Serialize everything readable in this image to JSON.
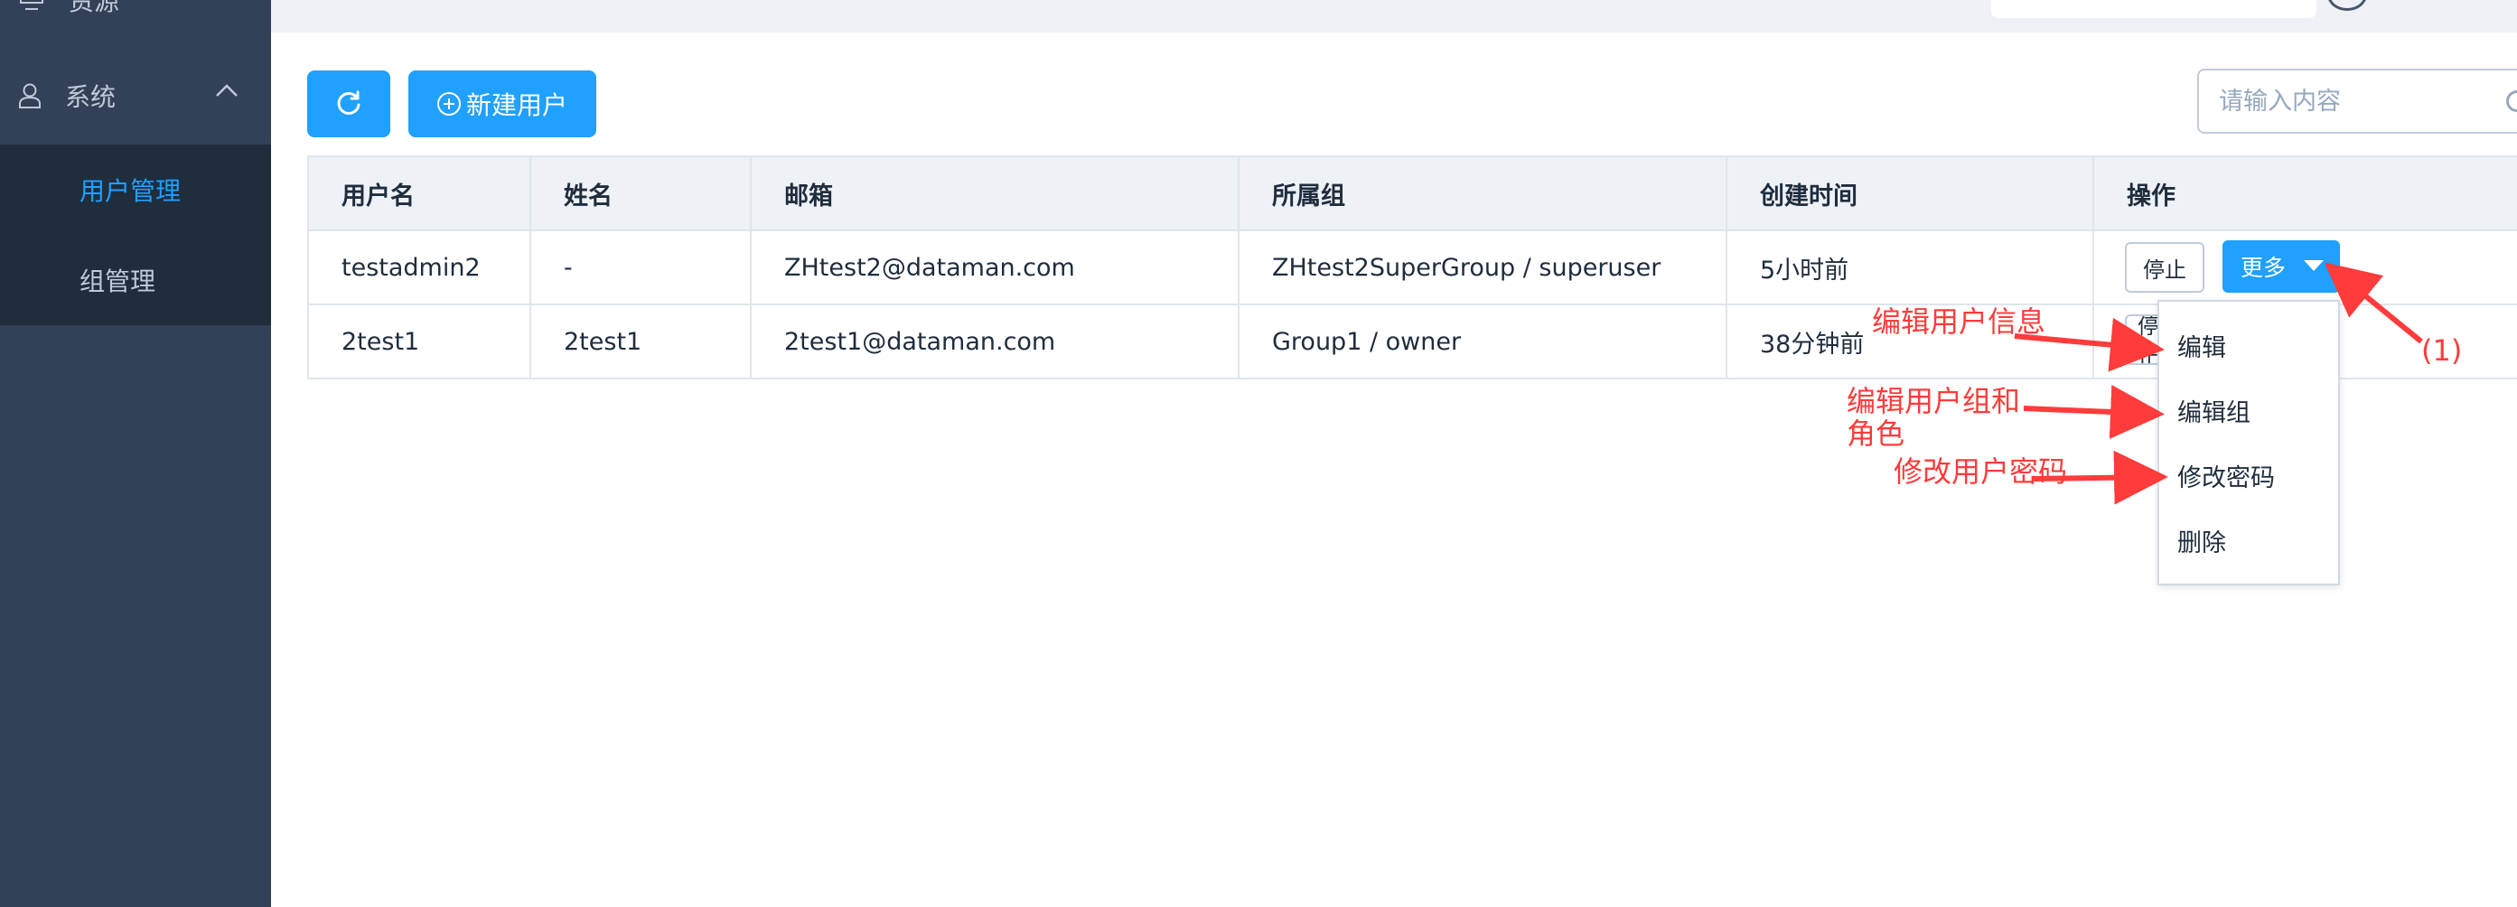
{
  "sidebar": {
    "cut_item_label": "资源",
    "group_label": "系统",
    "sub_items": [
      {
        "label": "用户管理",
        "active": true
      },
      {
        "label": "组管理",
        "active": false
      }
    ]
  },
  "toolbar": {
    "refresh_icon": "refresh-icon",
    "new_user_label": "新建用户",
    "search_placeholder": "请输入内容"
  },
  "table": {
    "headers": [
      "用户名",
      "姓名",
      "邮箱",
      "所属组",
      "创建时间",
      "操作"
    ],
    "rows": [
      {
        "username": "testadmin2",
        "name": "-",
        "email": "ZHtest2@dataman.com",
        "group": "ZHtest2SuperGroup / superuser",
        "created": "5小时前"
      },
      {
        "username": "2test1",
        "name": "2test1",
        "email": "2test1@dataman.com",
        "group": "Group1 / owner",
        "created": "38分钟前"
      }
    ],
    "stop_label": "停止",
    "more_label": "更多"
  },
  "dropdown": {
    "items": [
      "编辑",
      "编辑组",
      "修改密码",
      "删除"
    ]
  },
  "annotations": {
    "edit_info": "编辑用户信息",
    "edit_group_line1": "编辑用户组和",
    "edit_group_line2": "角色",
    "change_password": "修改用户密码",
    "step": "(1)"
  },
  "colors": {
    "sidebar_bg": "#324157",
    "submenu_bg": "#1f2d3d",
    "accent": "#20a0ff",
    "annotation": "#ff3b3b"
  }
}
